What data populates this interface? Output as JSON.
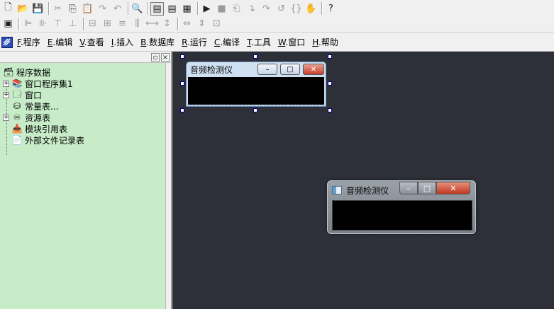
{
  "toolbar1": [
    {
      "icon": "new-file-icon",
      "glyph": "🗋"
    },
    {
      "icon": "open-folder-icon",
      "glyph": "📂"
    },
    {
      "icon": "save-icon",
      "glyph": "💾"
    },
    {
      "sep": true
    },
    {
      "icon": "cut-icon",
      "glyph": "✂",
      "dim": true
    },
    {
      "icon": "copy-icon",
      "glyph": "⎘"
    },
    {
      "icon": "paste-icon",
      "glyph": "📋",
      "dim": true
    },
    {
      "icon": "redo-icon",
      "glyph": "↷",
      "dim": true
    },
    {
      "icon": "undo-icon",
      "glyph": "↶",
      "dim": true
    },
    {
      "sep": true
    },
    {
      "icon": "find-icon",
      "glyph": "🔍"
    },
    {
      "sep": true
    },
    {
      "icon": "layout-left-icon",
      "glyph": "▤",
      "framed": true
    },
    {
      "icon": "layout-top-icon",
      "glyph": "▤"
    },
    {
      "icon": "layout-grid-icon",
      "glyph": "▦"
    },
    {
      "sep": true
    },
    {
      "icon": "run-icon",
      "glyph": "▶"
    },
    {
      "icon": "stop-icon",
      "glyph": "■",
      "dim": true
    },
    {
      "icon": "step-icon",
      "glyph": "⎗",
      "dim": true
    },
    {
      "icon": "step-into-icon",
      "glyph": "↴",
      "dim": true
    },
    {
      "icon": "step-over-icon",
      "glyph": "↷",
      "dim": true
    },
    {
      "icon": "step-out-icon",
      "glyph": "↺",
      "dim": true
    },
    {
      "icon": "watch-icon",
      "glyph": "{}",
      "dim": true
    },
    {
      "icon": "hand-icon",
      "glyph": "✋",
      "dim": true
    },
    {
      "sep": true
    },
    {
      "icon": "help-icon",
      "glyph": "?"
    }
  ],
  "toolbar2": [
    {
      "icon": "form-icon",
      "glyph": "▣"
    },
    {
      "sep": true
    },
    {
      "icon": "align-left-icon",
      "glyph": "⊫",
      "dim": true
    },
    {
      "icon": "align-right-icon",
      "glyph": "⊪",
      "dim": true
    },
    {
      "icon": "align-top-icon",
      "glyph": "⊤",
      "dim": true
    },
    {
      "icon": "align-bottom-icon",
      "glyph": "⊥",
      "dim": true
    },
    {
      "sep": true
    },
    {
      "icon": "center-h-icon",
      "glyph": "⊟",
      "dim": true
    },
    {
      "icon": "center-v-icon",
      "glyph": "⊞",
      "dim": true
    },
    {
      "icon": "space-h-icon",
      "glyph": "≡",
      "dim": true
    },
    {
      "icon": "space-v-icon",
      "glyph": "⫼",
      "dim": true
    },
    {
      "icon": "same-width-icon",
      "glyph": "⟷",
      "dim": true
    },
    {
      "icon": "same-height-icon",
      "glyph": "↕",
      "dim": true
    },
    {
      "sep": true
    },
    {
      "icon": "size-w-icon",
      "glyph": "⇔",
      "dim": true
    },
    {
      "icon": "size-h-icon",
      "glyph": "⇕",
      "dim": true
    },
    {
      "icon": "size-both-icon",
      "glyph": "⊡",
      "dim": true
    }
  ],
  "menu": [
    {
      "acc": "F",
      "rest": ".程序"
    },
    {
      "acc": "E",
      "rest": ".编辑"
    },
    {
      "acc": "V",
      "rest": ".查看"
    },
    {
      "acc": "I",
      "rest": ".插入"
    },
    {
      "acc": "B",
      "rest": ".数据库"
    },
    {
      "acc": "R",
      "rest": ".运行"
    },
    {
      "acc": "C",
      "rest": ".编译"
    },
    {
      "acc": "T",
      "rest": ".工具"
    },
    {
      "acc": "W",
      "rest": ".窗口"
    },
    {
      "acc": "H",
      "rest": ".帮助"
    }
  ],
  "sidebar": {
    "pin_label": "▫",
    "close_label": "×",
    "tree": [
      {
        "label": "程序数据",
        "icon": "program-data-icon",
        "glyph": "🗃",
        "level": 0,
        "exp": ""
      },
      {
        "label": "窗口程序集1",
        "icon": "assembly-icon",
        "glyph": "📚",
        "level": 1,
        "exp": "+"
      },
      {
        "label": "窗口",
        "icon": "window-icon",
        "glyph": "🗔",
        "level": 1,
        "exp": "+"
      },
      {
        "label": "常量表...",
        "icon": "constant-icon",
        "glyph": "⛁",
        "level": 1,
        "exp": ""
      },
      {
        "label": "资源表",
        "icon": "resource-icon",
        "glyph": "♾",
        "level": 1,
        "exp": "+"
      },
      {
        "label": "模块引用表",
        "icon": "module-ref-icon",
        "glyph": "📥",
        "level": 1,
        "exp": ""
      },
      {
        "label": "外部文件记录表",
        "icon": "external-file-icon",
        "glyph": "📄",
        "level": 1,
        "exp": ""
      }
    ]
  },
  "design_window": {
    "title": "音频检测仪",
    "min": "–",
    "max": "□",
    "close": "✕"
  },
  "preview_window": {
    "title": "音频检测仪",
    "min": "–",
    "max": "□",
    "close": "✕"
  }
}
